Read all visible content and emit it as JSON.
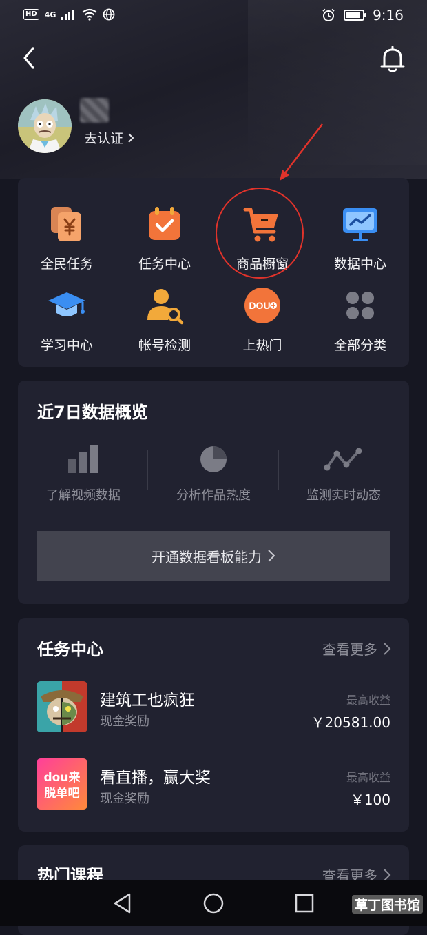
{
  "status_bar": {
    "hd": "HD",
    "network": "4G",
    "time": "9:16",
    "battery_level": 0.85
  },
  "header": {
    "back_icon": "chevron-left-icon",
    "notification_icon": "bell-icon",
    "verify_text": "去认证"
  },
  "tools": [
    {
      "label": "全民任务",
      "icon": "yuan-cards-icon",
      "color": "#f29a5b"
    },
    {
      "label": "任务中心",
      "icon": "calendar-check-icon",
      "color": "#f2743a"
    },
    {
      "label": "商品橱窗",
      "icon": "shopping-cart-icon",
      "color": "#f2743a"
    },
    {
      "label": "数据中心",
      "icon": "presentation-chart-icon",
      "color": "#3a8ef2"
    },
    {
      "label": "学习中心",
      "icon": "graduation-cap-icon",
      "color": "#3a8ef2"
    },
    {
      "label": "帐号检测",
      "icon": "user-search-icon",
      "color": "#f2a93a"
    },
    {
      "label": "上热门",
      "icon": "dou-plus-icon",
      "color": "#f2743a"
    },
    {
      "label": "全部分类",
      "icon": "grid-dots-icon",
      "color": "#7b7c86"
    }
  ],
  "data_overview": {
    "title": "近7日数据概览",
    "metrics": [
      {
        "label": "了解视频数据",
        "icon": "bar-chart-icon"
      },
      {
        "label": "分析作品热度",
        "icon": "pie-chart-icon"
      },
      {
        "label": "监测实时动态",
        "icon": "line-trend-icon"
      }
    ],
    "open_button": "开通数据看板能力"
  },
  "task_center": {
    "title": "任务中心",
    "see_more": "查看更多",
    "tasks": [
      {
        "name": "建筑工也疯狂",
        "sub": "现金奖励",
        "earn_label": "最高收益",
        "earn_value": "￥20581.00"
      },
      {
        "name": "看直播，赢大奖",
        "sub": "现金奖励",
        "earn_label": "最高收益",
        "earn_value": "￥100",
        "thumb_text_1": "dou来",
        "thumb_text_2": "脱单吧"
      }
    ]
  },
  "courses": {
    "title": "热门课程",
    "see_more": "查看更多"
  },
  "nav": {
    "back": "triangle-back-icon",
    "home": "circle-home-icon",
    "recents": "square-recents-icon"
  },
  "watermark": "草丁图书馆",
  "dou_text": "DOU"
}
